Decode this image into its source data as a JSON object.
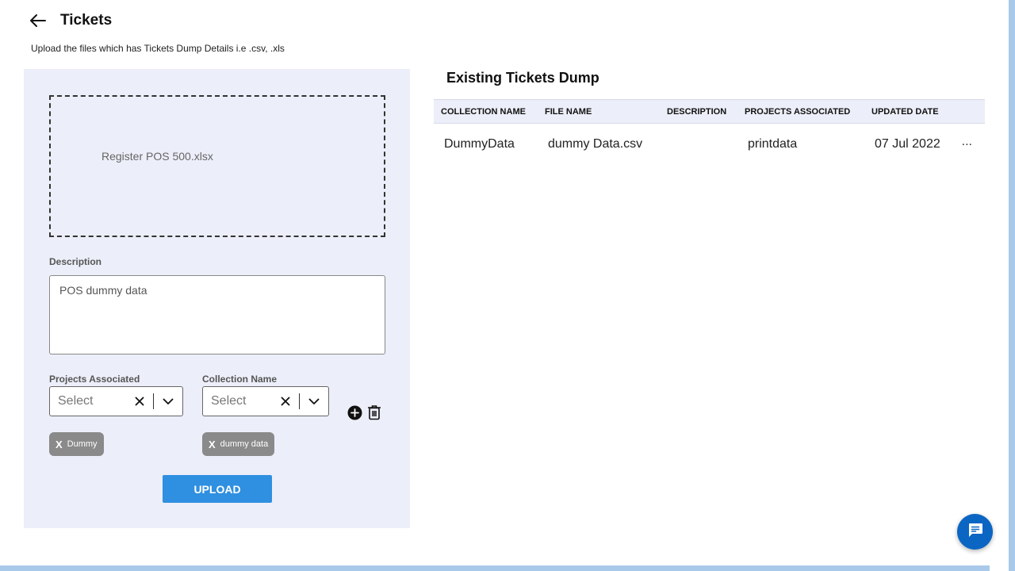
{
  "header": {
    "title": "Tickets",
    "back_icon": "arrow-left-icon",
    "subtitle": "Upload the files which has Tickets Dump Details i.e .csv, .xls"
  },
  "upload": {
    "file_name": "Register POS 500.xlsx",
    "description_label": "Description",
    "description_value": "POS dummy data",
    "projects_label": "Projects Associated",
    "projects_placeholder": "Select",
    "projects_chip": "Dummy",
    "collection_label": "Collection Name",
    "collection_placeholder": "Select",
    "collection_chip": "dummy data",
    "chip_remove": "X",
    "upload_label": "UPLOAD"
  },
  "existing": {
    "title": "Existing Tickets Dump",
    "columns": [
      "COLLECTION NAME",
      "FILE NAME",
      "DESCRIPTION",
      "PROJECTS ASSOCIATED",
      "UPDATED DATE"
    ],
    "rows": [
      {
        "collection_name": "DummyData",
        "file_name": "dummy Data.csv",
        "description": "",
        "projects_associated": "printdata",
        "updated_date": "07 Jul 2022",
        "menu": "..."
      }
    ]
  },
  "colors": {
    "panel_bg": "#eceef9",
    "primary": "#2f8fe0",
    "chip_bg": "#8a8a8a",
    "fab": "#0b66c3",
    "scrollbar": "#a9c9ea"
  }
}
